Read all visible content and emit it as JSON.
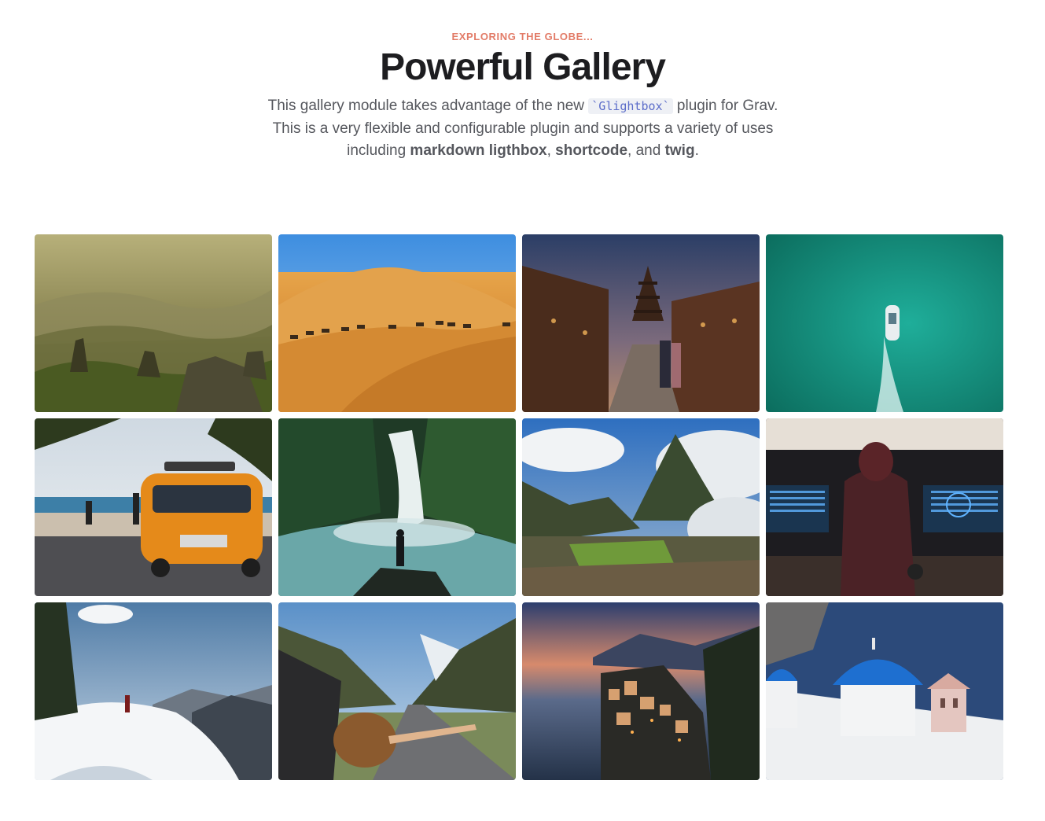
{
  "header": {
    "kicker": "EXPLORING THE GLOBE...",
    "title": "Powerful Gallery",
    "intro_1": "This gallery module takes advantage of the new ",
    "intro_code": "`Glightbox`",
    "intro_2": " plugin for Grav. This is a very flexible and configurable plugin and supports a variety of uses including ",
    "intro_bold_1": "markdown ligthbox",
    "intro_3": ", ",
    "intro_bold_2": "shortcode",
    "intro_4": ", and ",
    "intro_bold_3": "twig",
    "intro_5": "."
  },
  "colors": {
    "kicker": "#e27b67",
    "title": "#1d1d20",
    "body_text": "#55575d",
    "code_text": "#5b6cc9"
  },
  "gallery": {
    "images": [
      {
        "subject": "misty-mountain-valley"
      },
      {
        "subject": "desert-camel-caravan"
      },
      {
        "subject": "kyoto-street-pagoda"
      },
      {
        "subject": "boat-turquoise-sea"
      },
      {
        "subject": "orange-camper-van-beach"
      },
      {
        "subject": "waterfall-hiker"
      },
      {
        "subject": "machu-picchu-clouds"
      },
      {
        "subject": "traveler-departures-board"
      },
      {
        "subject": "snowy-mountain-hiker"
      },
      {
        "subject": "car-window-mountain-road"
      },
      {
        "subject": "cinque-terre-sunset"
      },
      {
        "subject": "santorini-blue-domes"
      }
    ]
  }
}
